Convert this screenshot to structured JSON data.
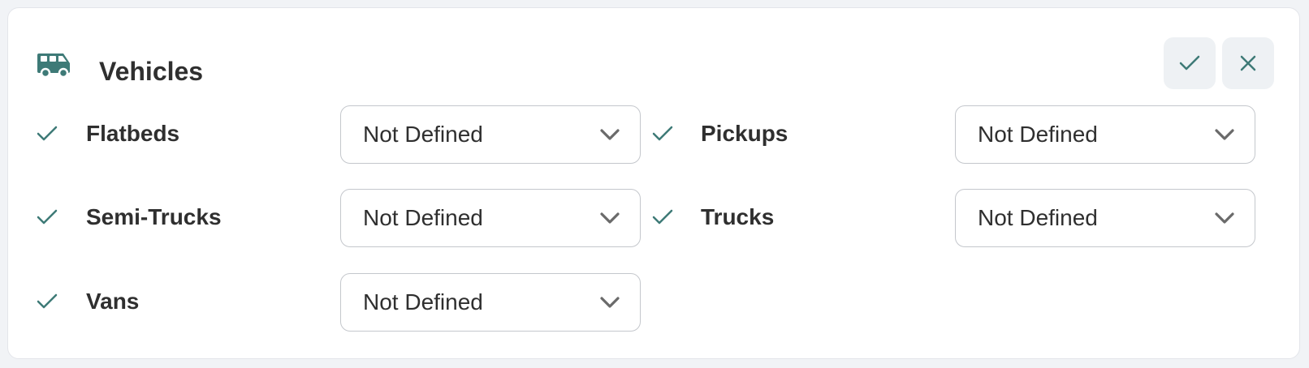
{
  "header": {
    "title": "Vehicles",
    "icon": "van-icon",
    "accent_color": "#3e7a77",
    "confirm_icon": "check-icon",
    "cancel_icon": "close-icon"
  },
  "rows": [
    {
      "label": "Flatbeds",
      "value": "Not Defined"
    },
    {
      "label": "Pickups",
      "value": "Not Defined"
    },
    {
      "label": "Semi-Trucks",
      "value": "Not Defined"
    },
    {
      "label": "Trucks",
      "value": "Not Defined"
    },
    {
      "label": "Vans",
      "value": "Not Defined"
    }
  ]
}
